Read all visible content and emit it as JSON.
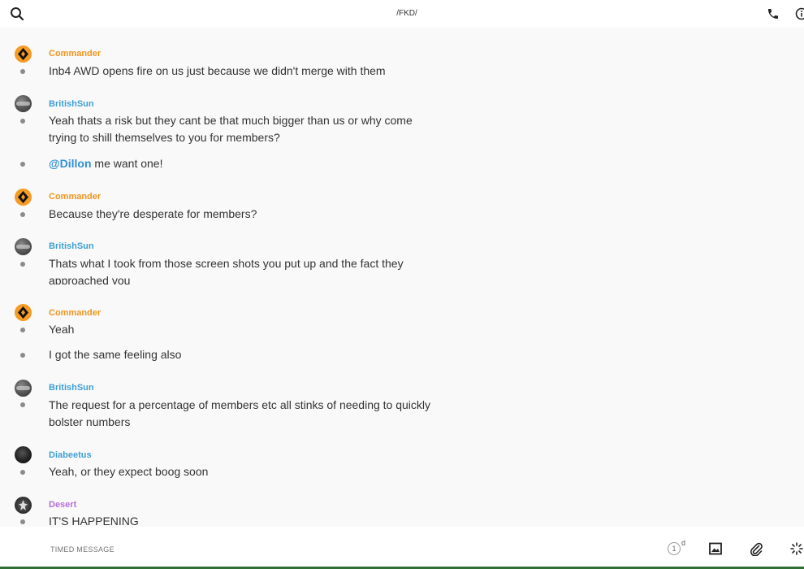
{
  "header": {
    "title": "/FKD/",
    "icons": [
      "search-icon",
      "phone-icon",
      "info-icon"
    ]
  },
  "messages": [
    {
      "author": "Commander",
      "avatar": "commander",
      "name_color": "#f0951e",
      "texts": [
        "Inb4 AWD opens fire on us just because we didn't merge with them"
      ]
    },
    {
      "author": "BritishSun",
      "avatar": "british",
      "name_color": "#3fa0d6",
      "texts": [
        "Yeah thats a risk but they cant be that much bigger than us or why come trying to shill themselves to you for members?"
      ],
      "mention": "@Dillon",
      "mention_rest": " me want one!"
    },
    {
      "author": "Commander",
      "avatar": "commander",
      "name_color": "#f0951e",
      "texts": [
        "Because they're desperate for members?"
      ]
    },
    {
      "author": "BritishSun",
      "avatar": "british",
      "name_color": "#3fa0d6",
      "texts": [
        "Thats what I took from those screen shots you put up and the fact they approached you"
      ]
    },
    {
      "author": "Commander",
      "avatar": "commander",
      "name_color": "#f0951e",
      "texts": [
        "Yeah",
        "I got the same feeling also"
      ]
    },
    {
      "author": "BritishSun",
      "avatar": "british",
      "name_color": "#3fa0d6",
      "texts": [
        "The request for a percentage of members etc all stinks of needing to quickly bolster numbers"
      ]
    },
    {
      "author": "Diabeetus",
      "avatar": "diabeetus",
      "name_color": "#3fa0d6",
      "texts": [
        "Yeah, or they expect boog soon"
      ]
    },
    {
      "author": "Desert",
      "avatar": "desert",
      "name_color": "#b56fd6",
      "texts": [
        "IT'S HAPPENING"
      ]
    }
  ],
  "composer": {
    "placeholder": "TIMED MESSAGE",
    "timer_value": "1",
    "timer_unit": "d",
    "icons": [
      "timer-icon",
      "image-icon",
      "attachment-icon",
      "loading-icon"
    ]
  },
  "colors": {
    "background": "#f9f9f9",
    "commander": "#f0951e",
    "british": "#3fa0d6",
    "desert": "#b56fd6",
    "mention": "#2f8fd3",
    "bottom_bar": "#2f6f33"
  }
}
